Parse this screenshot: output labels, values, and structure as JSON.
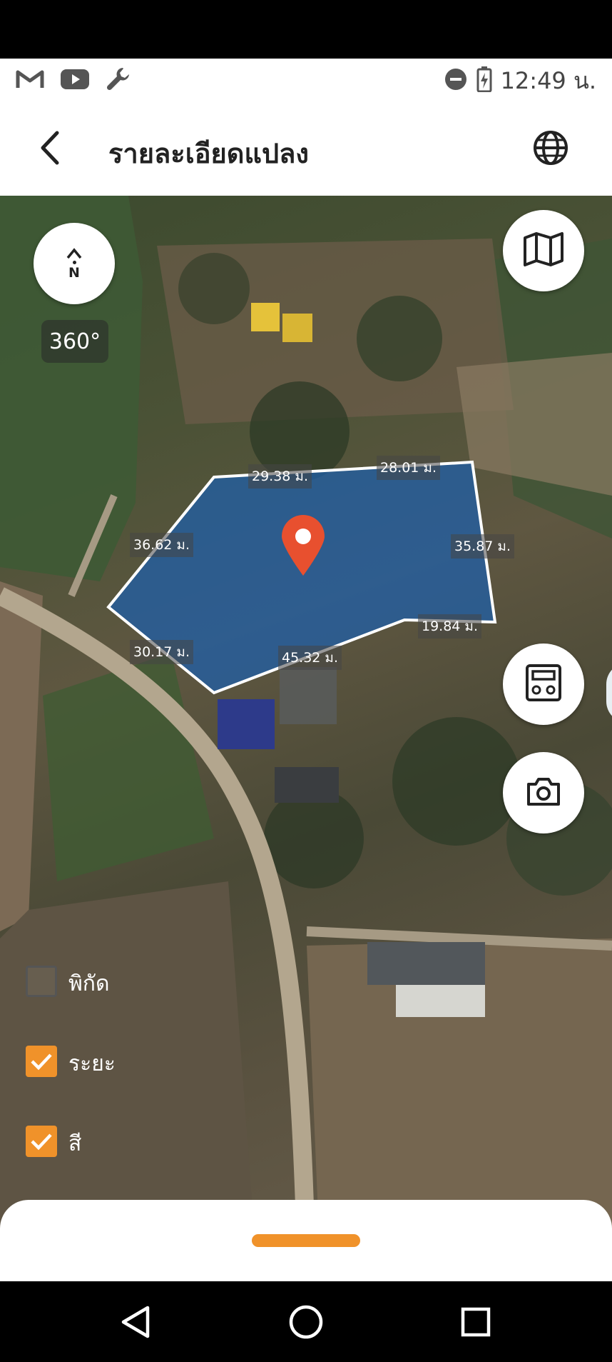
{
  "status_bar": {
    "time": "12:49 น.",
    "icons": [
      "gmail-icon",
      "youtube-icon",
      "wrench-icon",
      "do-not-disturb-icon",
      "battery-charging-icon"
    ]
  },
  "header": {
    "title": "รายละเอียดแปลง",
    "back_icon": "chevron-left-icon",
    "language_icon": "globe-icon"
  },
  "map": {
    "compass_label": "N",
    "heading": "360°",
    "edge_lengths": [
      "29.38 ม.",
      "28.01 ม.",
      "36.62 ม.",
      "35.87 ม.",
      "19.84 ม.",
      "30.17 ม.",
      "45.32 ม."
    ],
    "layers": [
      {
        "label": "พิกัด",
        "checked": false
      },
      {
        "label": "ระยะ",
        "checked": true
      },
      {
        "label": "สี",
        "checked": true
      }
    ],
    "buttons": [
      "map-layers-icon",
      "calculator-icon",
      "camera-icon"
    ],
    "colors": {
      "parcel_fill": "#1f5fa8",
      "parcel_stroke": "#ffffff",
      "pin": "#e8502f",
      "accent": "#f0922a"
    }
  },
  "navigation": {
    "buttons": [
      "back-triangle-icon",
      "home-circle-icon",
      "recents-square-icon"
    ]
  }
}
